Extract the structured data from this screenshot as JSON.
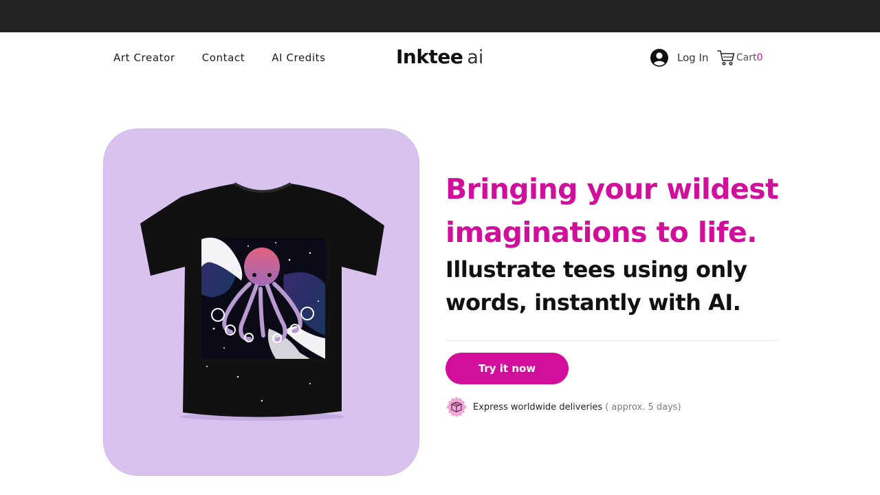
{
  "header": {
    "nav": [
      {
        "label": "Art Creator"
      },
      {
        "label": "Contact"
      },
      {
        "label": "AI Credits"
      }
    ],
    "logo": {
      "main": "Inktee",
      "suffix": "ai"
    },
    "account": {
      "login_label": "Log In",
      "icon": "user-avatar-icon"
    },
    "cart": {
      "label": "Cart",
      "count": "0",
      "icon": "shopping-cart-icon"
    }
  },
  "hero": {
    "headline": "Bringing your wildest imaginations to life.",
    "subheadline": "Illustrate tees using only words, instantly with AI.",
    "cta_label": "Try it now",
    "delivery": {
      "text": "Express worldwide deliveries",
      "note": "( approx. 5 days)",
      "icon": "package-box-icon"
    },
    "image": {
      "subject": "black t-shirt with octopus print"
    }
  },
  "colors": {
    "accent": "#d10f9b",
    "card_background": "#d8c3ef",
    "top_strip": "#232323",
    "text_dark": "#111111"
  }
}
